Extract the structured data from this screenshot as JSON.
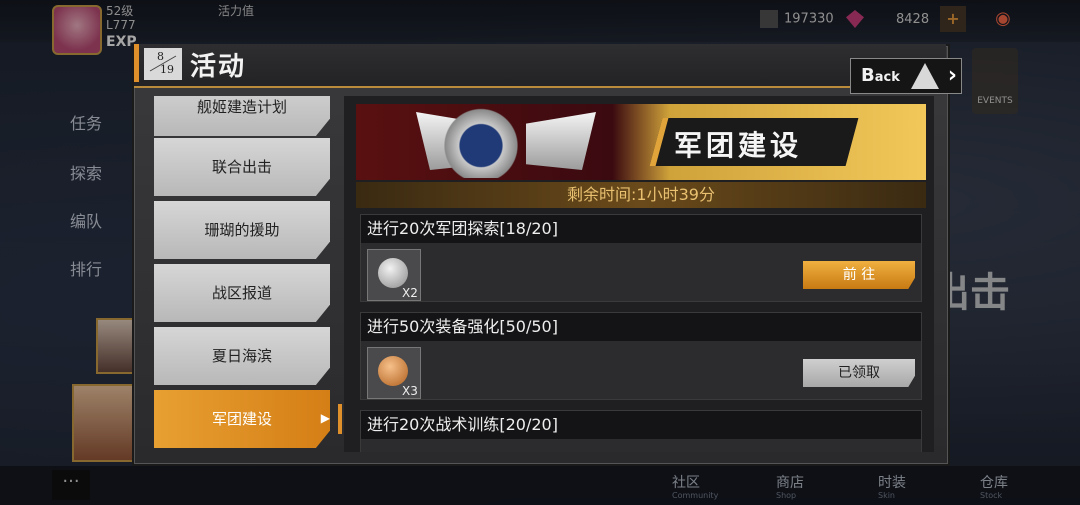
{
  "hud": {
    "level": "52级",
    "name": "L777",
    "exp_label": "EXP",
    "stamina_label": "活力值",
    "currency1": "197330",
    "currency2": "8428",
    "plus": "+",
    "eye": "◉",
    "events_label": "EVENTS"
  },
  "left_menu": {
    "tasks": "任务",
    "explore": "探索",
    "fleet": "编队",
    "rank": "排行"
  },
  "header": {
    "page_current": "8",
    "page_total": "19",
    "title": "活动",
    "back_label": "B",
    "back_label_rest": "ack",
    "back_chevron": "›"
  },
  "tabs": [
    {
      "label": "舰姬建造计划"
    },
    {
      "label": "联合出击"
    },
    {
      "label": "珊瑚的援助"
    },
    {
      "label": "战区报道"
    },
    {
      "label": "夏日海滨"
    },
    {
      "label": "军团建设",
      "active": true
    }
  ],
  "banner": {
    "title": "军团建设"
  },
  "timer": "剩余时间:1小时39分",
  "tasks": [
    {
      "title": "进行20次军团探索[18/20]",
      "qty": "X2",
      "button": "前 往",
      "state": "go",
      "coin": "#b8b8b8"
    },
    {
      "title": "进行50次装备强化[50/50]",
      "qty": "X3",
      "button": "已领取",
      "state": "done",
      "coin": "#d88a3a"
    },
    {
      "title": "进行20次战术训练[20/20]",
      "qty": "",
      "button": "",
      "state": "none",
      "coin": "#b8b8b8"
    }
  ],
  "bottom_nav": [
    {
      "label": "社区",
      "sub": "Community"
    },
    {
      "label": "商店",
      "sub": "Shop"
    },
    {
      "label": "时装",
      "sub": "Skin"
    },
    {
      "label": "仓库",
      "sub": "Stock"
    }
  ],
  "menu_dots": "···",
  "sortie": "出击"
}
